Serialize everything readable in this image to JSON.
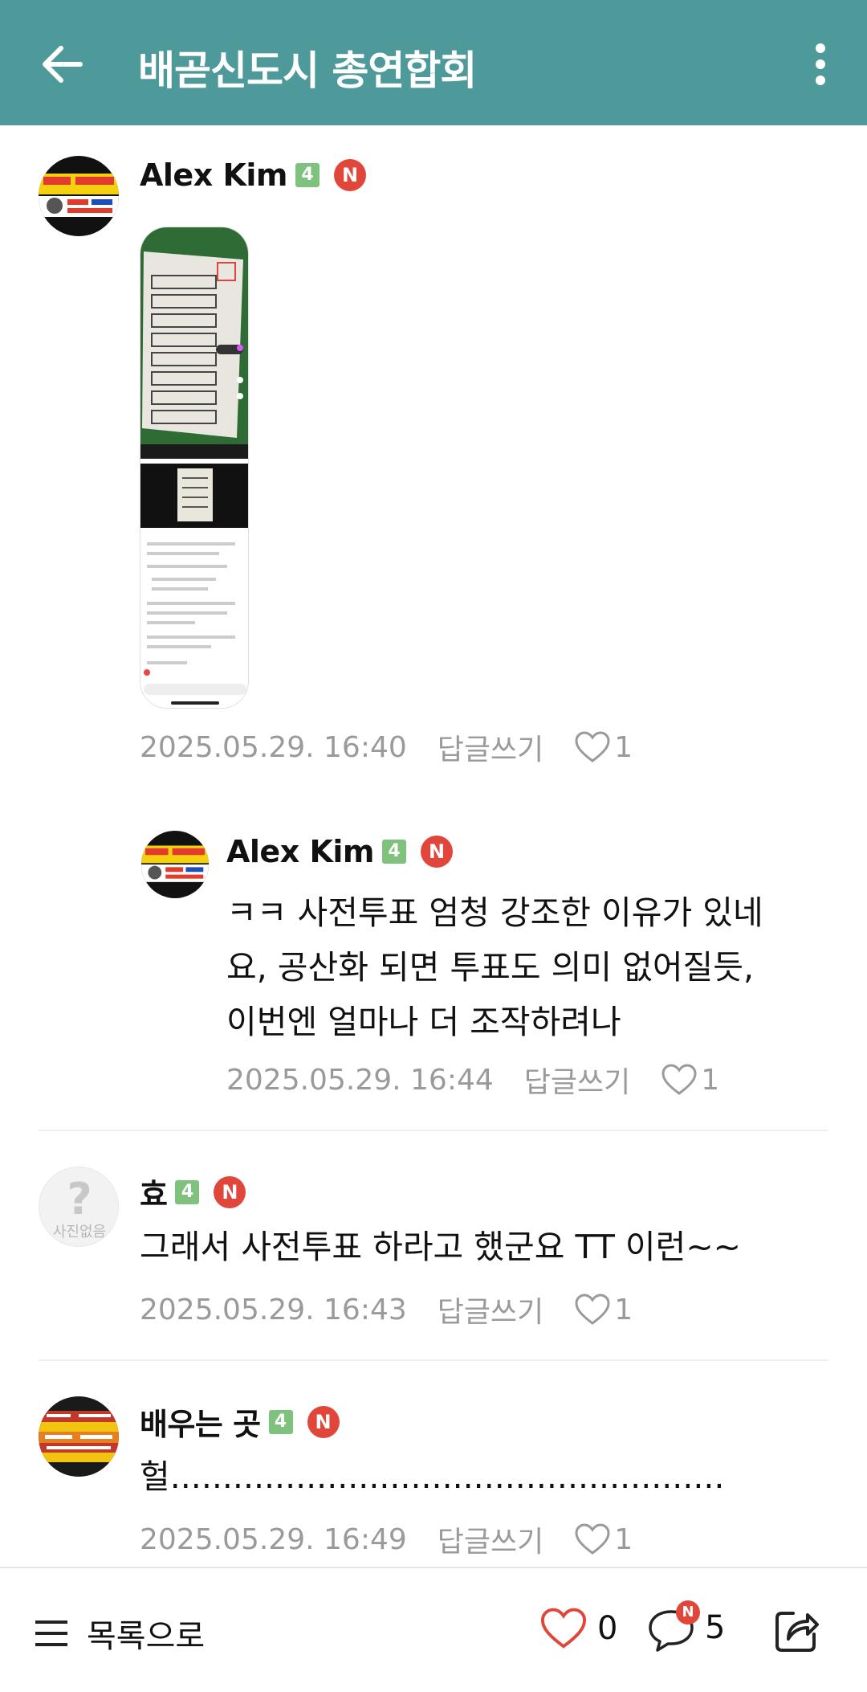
{
  "header": {
    "title": "배곧신도시 총연합회",
    "back_icon": "arrow-left-icon",
    "more_icon": "vertical-dots-icon"
  },
  "comments": [
    {
      "author": "Alex Kim",
      "level": "4",
      "new_badge": "N",
      "attachment": "screenshot-image",
      "date": "2025.05.29. 16:40",
      "reply_label": "답글쓰기",
      "likes": "1"
    },
    {
      "author": "Alex Kim",
      "level": "4",
      "new_badge": "N",
      "text_lines": [
        "ㅋㅋ 사전투표 엄청 강조한 이유가 있네",
        "요, 공산화 되면 투표도 의미 없어질듯,",
        "이번엔 얼마나 더 조작하려나"
      ],
      "date": "2025.05.29. 16:44",
      "reply_label": "답글쓰기",
      "likes": "1"
    },
    {
      "author": "효",
      "level": "4",
      "new_badge": "N",
      "avatar_text": "사진없음",
      "text": "그래서 사전투표 하라고 했군요 TT 이런~~",
      "date": "2025.05.29. 16:43",
      "reply_label": "답글쓰기",
      "likes": "1"
    },
    {
      "author": "배우는 곳",
      "level": "4",
      "new_badge": "N",
      "text": "헐.....................................................",
      "date": "2025.05.29. 16:49",
      "reply_label": "답글쓰기",
      "likes": "1"
    }
  ],
  "bottom_bar": {
    "list_label": "목록으로",
    "like_count": "0",
    "comment_count": "5",
    "comment_new_badge": "N"
  },
  "colors": {
    "header_bg": "#4e9a9a",
    "badge_red": "#e1463b",
    "level_green": "#7fc27d",
    "meta_gray": "#9a9a9a"
  }
}
